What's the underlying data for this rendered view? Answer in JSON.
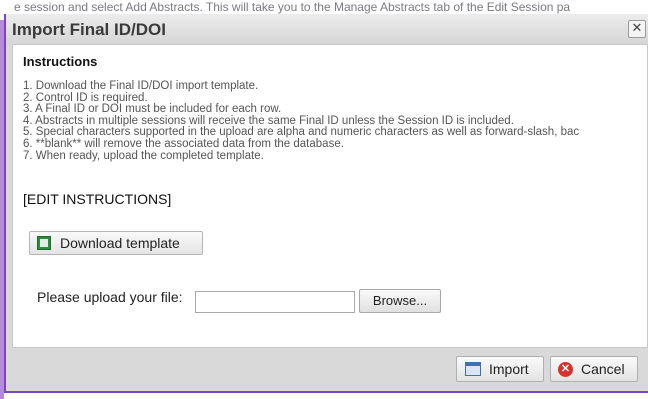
{
  "background_text": "e session and select Add Abstracts. This will take you to the Manage Abstracts tab of the Edit Session pa",
  "dialog": {
    "title": "Import Final ID/DOI",
    "close_glyph": "✕"
  },
  "instructions": {
    "heading": "Instructions",
    "items": [
      "1. Download the Final ID/DOI import template.",
      "2. Control ID is required.",
      "3. A Final ID or DOI must be included for each row.",
      "4. Abstracts in multiple sessions will receive the same Final ID unless the Session ID is included.",
      "5. Special characters supported in the upload are alpha and numeric characters as well as forward-slash, bac",
      "6. **blank** will remove the associated data from the database.",
      "7. When ready, upload the completed template."
    ],
    "edit_link": "[EDIT INSTRUCTIONS]"
  },
  "download": {
    "label": "Download template",
    "icon": "excel-icon"
  },
  "upload": {
    "label": "Please upload your file:",
    "value": "",
    "browse_label": "Browse..."
  },
  "footer": {
    "import_label": "Import",
    "import_icon": "table-icon",
    "cancel_label": "Cancel",
    "cancel_icon": "cancel-icon"
  },
  "colors": {
    "accent_border": "#7d44c9",
    "cancel_red": "#d9322e",
    "excel_green": "#2d8a3e"
  }
}
